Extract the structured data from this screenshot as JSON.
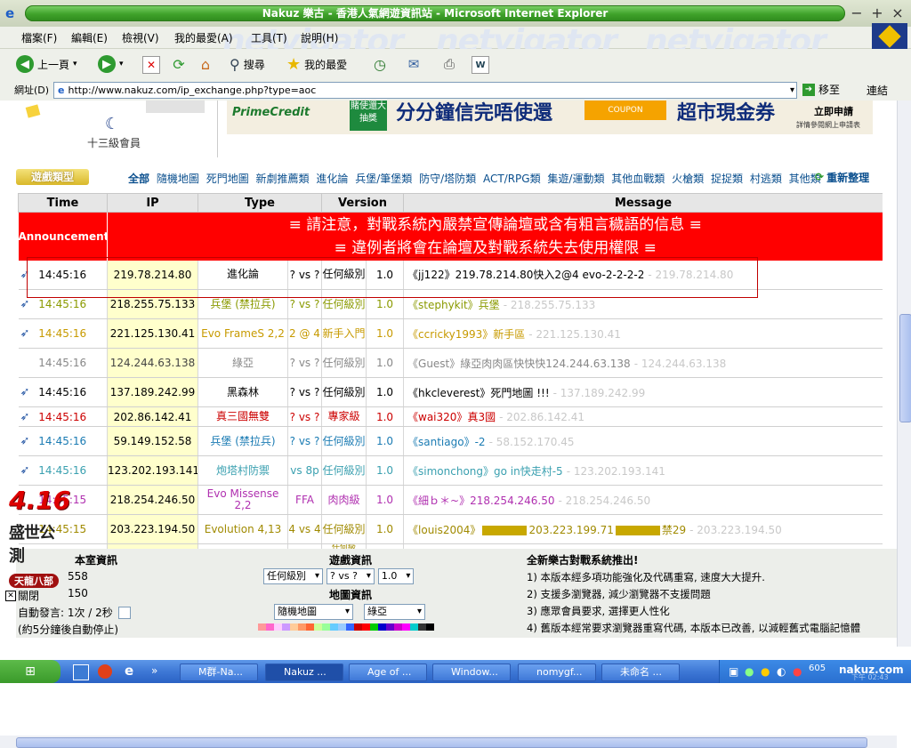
{
  "window": {
    "title": "Nakuz 樂古 - 香港人氣網遊資訊站 - Microsoft Internet Explorer"
  },
  "menubar": {
    "items": [
      "檔案(F)",
      "編輯(E)",
      "檢視(V)",
      "我的最愛(A)",
      "工具(T)",
      "說明(H)"
    ],
    "watermark": "netvigator"
  },
  "toolbar": {
    "back": "上一頁",
    "search": "搜尋",
    "favorites": "我的最愛"
  },
  "addressbar": {
    "label": "網址(D)",
    "url": "http://www.nakuz.com/ip_exchange.php?type=aoc",
    "go": "移至",
    "links": "連結"
  },
  "header": {
    "member_level": "十三級會員",
    "ad_brand": "PrimeCredit",
    "ad_text1": "分分鐘信完唔使還",
    "ad_text2": "超市現金券",
    "ad_btn_text": "立即申請",
    "ad_btn_sub": "詳情參閱網上申請表",
    "ad_stamp": "賭使還大抽獎",
    "coupon": "COUPON"
  },
  "categories": {
    "logo_text": "遊戲類型",
    "items": [
      "全部",
      "隨機地圖",
      "死門地圖",
      "新劇推薦類",
      "進化論",
      "兵堡/筆堡類",
      "防守/塔防類",
      "ACT/RPG類",
      "集遊/運動類",
      "其他血戰類",
      "火槍類",
      "捉捉類",
      "村逃類",
      "其他類"
    ],
    "refresh": "重新整理"
  },
  "table": {
    "headers": [
      "Time",
      "IP",
      "Type",
      "Version",
      "Message"
    ],
    "announcement_label": "Announcement",
    "announcement_line1": "≡ 請注意，對戰系統內嚴禁宣傳論壇或含有粗言穢語的信息 ≡",
    "announcement_line2": "≡ 違例者將會在論壇及對戰系統失去使用權限 ≡",
    "rows": [
      {
        "time": "14:45:16",
        "ip": "219.78.214.80",
        "type": "進化論",
        "players": "? vs ?",
        "level": "任何級別",
        "version": "1.0",
        "msg_user": "《jj122》",
        "msg_text": "219.78.214.80快入2@4 evo-2-2-2-2",
        "msg_ip": "- 219.78.214.80",
        "color": "#000000",
        "arrow": true
      },
      {
        "time": "14:45:16",
        "ip": "218.255.75.133",
        "type": "兵堡 (禁拉兵)",
        "players": "? vs ?",
        "level": "任何級別",
        "version": "1.0",
        "msg_user": "《stephykit》",
        "msg_text": "兵堡",
        "msg_ip": "- 218.255.75.133",
        "color": "#8a9a00",
        "arrow": true
      },
      {
        "time": "14:45:16",
        "ip": "221.125.130.41",
        "type": "Evo FrameS 2,2",
        "players": "2 @ 4",
        "level": "新手入門",
        "version": "1.0",
        "msg_user": "《ccricky1993》",
        "msg_text": "新手區",
        "msg_ip": "- 221.125.130.41",
        "color": "#c79a00",
        "arrow": true
      },
      {
        "time": "14:45:16",
        "ip": "124.244.63.138",
        "type": "綠亞",
        "players": "? vs ?",
        "level": "任何級別",
        "version": "1.0",
        "msg_user": "《Guest》",
        "msg_text": "綠亞肉肉區快快快124.244.63.138",
        "msg_ip": "- 124.244.63.138",
        "color": "#888888",
        "arrow": false
      },
      {
        "time": "14:45:16",
        "ip": "137.189.242.99",
        "type": "黑森林",
        "players": "? vs ?",
        "level": "任何級別",
        "version": "1.0",
        "msg_user": "《hkcleverest》",
        "msg_text": "死門地圖 !!!",
        "msg_ip": "- 137.189.242.99",
        "color": "#000000",
        "arrow": true
      },
      {
        "time": "14:45:16",
        "ip": "202.86.142.41",
        "type": "真三國無雙",
        "players": "? vs ?",
        "level": "專家級",
        "version": "1.0",
        "msg_user": "《wai320》",
        "msg_text": "真3國",
        "msg_ip": "- 202.86.142.41",
        "color": "#cc0000",
        "arrow": true
      },
      {
        "time": "14:45:16",
        "ip": "59.149.152.58",
        "type": "兵堡 (禁拉兵)",
        "players": "? vs ?",
        "level": "任何級別",
        "version": "1.0",
        "msg_user": "《santiago》",
        "msg_text": "-2",
        "msg_ip": "- 58.152.170.45",
        "color": "#1a7bb3",
        "arrow": true
      },
      {
        "time": "14:45:16",
        "ip": "123.202.193.141",
        "type": "炮塔村防禦",
        "players": "vs 8p",
        "level": "任何級別",
        "version": "1.0",
        "msg_user": "《simonchong》",
        "msg_text": "go in快走村-5",
        "msg_ip": "- 123.202.193.141",
        "color": "#3aa0b0",
        "arrow": true
      },
      {
        "time": "14:45:15",
        "ip": "218.254.246.50",
        "type": "Evo Missense 2,2",
        "players": "FFA",
        "level": "肉肉級",
        "version": "1.0",
        "msg_user": "《細ｂ＊~》",
        "msg_text": "218.254.246.50",
        "msg_ip": "- 218.254.246.50",
        "color": "#b030b0",
        "arrow": false
      },
      {
        "time": "14:45:15",
        "ip": "203.223.194.50",
        "type": "Evolution 4,13",
        "players": "4 vs 4",
        "level": "任何級別",
        "version": "1.0",
        "msg_user": "《louis2004》",
        "msg_text": "203.223.199.71",
        "msg_suffix": "禁29",
        "msg_ip": "- 203.223.194.50",
        "color": "#a08a00",
        "arrow": false
      }
    ],
    "partial_row_level": "任何級"
  },
  "bottom": {
    "room_info_title": "本室資訊",
    "room_count1": "558",
    "room_count2": "150",
    "auto_speak": "自動發言: 1次 / 2秒",
    "auto_stop": "(約5分鐘後自動停止)",
    "close_label": "關閉",
    "game_info_title": "遊戲資訊",
    "level_select": "任何級別",
    "players_select": "? vs ?",
    "version_select": "1.0",
    "map_info_title": "地圖資訊",
    "map_select": "隨機地圖",
    "map_select2": "綠亞",
    "news_title": "全新樂古對戰系統推出!",
    "news": [
      "1) 本版本經多項功能強化及代碼重寫, 速度大大提升.",
      "2) 支援多瀏覽器, 減少瀏覽器不支援問題",
      "3) 應眾會員要求, 選擇更人性化",
      "4) 舊版本經常要求瀏覽器重寫代碼, 本版本已改善, 以減輕舊式電腦記憶體"
    ],
    "palette": [
      "#ff9999",
      "#ff66cc",
      "#ffccff",
      "#cc99ff",
      "#ffcc99",
      "#ff9966",
      "#ff6633",
      "#ccff99",
      "#99ff99",
      "#66ccff",
      "#99ccff",
      "#3366ff",
      "#cc0000",
      "#ff0000",
      "#00cc00",
      "#0000cc",
      "#6600cc",
      "#cc00cc",
      "#ff00ff",
      "#00cccc",
      "#333333",
      "#000000"
    ]
  },
  "overlay": {
    "big": "4.16",
    "text": "盛世公測",
    "sub": "天龍八部"
  },
  "taskbar": {
    "tasks": [
      "M群-Na...",
      "Nakuz ...",
      "Age of ...",
      "Window...",
      "nomygf...",
      "未命名 ..."
    ],
    "tray_num": "605",
    "brand": "nakuz.com",
    "clock": "下午 02:43"
  }
}
